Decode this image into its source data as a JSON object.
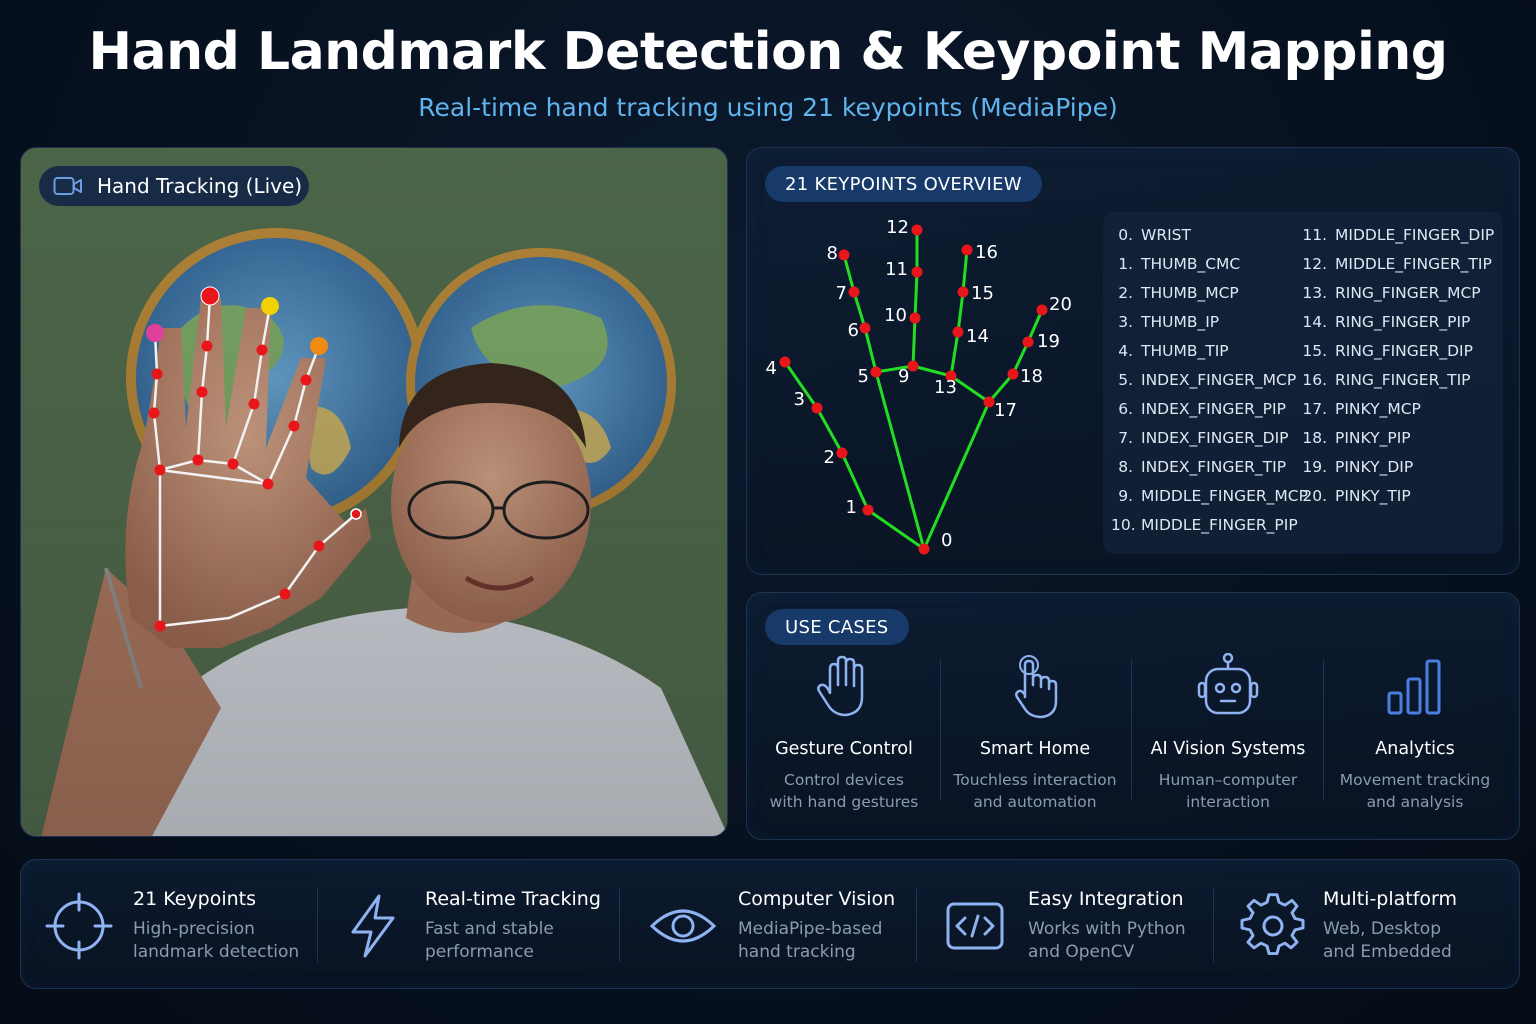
{
  "header": {
    "title": "Hand Landmark Detection & Keypoint Mapping",
    "subtitle": "Real-time hand tracking using 21 keypoints (MediaPipe)"
  },
  "camera": {
    "label": "Hand Tracking (Live)",
    "icon": "video-camera-icon"
  },
  "keypoints_panel": {
    "heading": "21 KEYPOINTS OVERVIEW",
    "diagram_labels": [
      "0",
      "1",
      "2",
      "3",
      "4",
      "5",
      "6",
      "7",
      "8",
      "9",
      "10",
      "11",
      "12",
      "13",
      "14",
      "15",
      "16",
      "17",
      "18",
      "19",
      "20"
    ],
    "list": [
      {
        "num": "0.",
        "name": "WRIST"
      },
      {
        "num": "1.",
        "name": "THUMB_CMC"
      },
      {
        "num": "2.",
        "name": "THUMB_MCP"
      },
      {
        "num": "3.",
        "name": "THUMB_IP"
      },
      {
        "num": "4.",
        "name": "THUMB_TIP"
      },
      {
        "num": "5.",
        "name": "INDEX_FINGER_MCP"
      },
      {
        "num": "6.",
        "name": "INDEX_FINGER_PIP"
      },
      {
        "num": "7.",
        "name": "INDEX_FINGER_DIP"
      },
      {
        "num": "8.",
        "name": "INDEX_FINGER_TIP"
      },
      {
        "num": "9.",
        "name": "MIDDLE_FINGER_MCP"
      },
      {
        "num": "10.",
        "name": "MIDDLE_FINGER_PIP"
      },
      {
        "num": "11.",
        "name": "MIDDLE_FINGER_DIP"
      },
      {
        "num": "12.",
        "name": "MIDDLE_FINGER_TIP"
      },
      {
        "num": "13.",
        "name": "RING_FINGER_MCP"
      },
      {
        "num": "14.",
        "name": "RING_FINGER_PIP"
      },
      {
        "num": "15.",
        "name": "RING_FINGER_DIP"
      },
      {
        "num": "16.",
        "name": "RING_FINGER_TIP"
      },
      {
        "num": "17.",
        "name": "PINKY_MCP"
      },
      {
        "num": "18.",
        "name": "PINKY_PIP"
      },
      {
        "num": "19.",
        "name": "PINKY_DIP"
      },
      {
        "num": "20.",
        "name": "PINKY_TIP"
      }
    ]
  },
  "use_cases": {
    "heading": "USE CASES",
    "items": [
      {
        "icon": "raised-hand-icon",
        "title": "Gesture Control",
        "desc1": "Control devices",
        "desc2": "with hand gestures"
      },
      {
        "icon": "pointing-hand-icon",
        "title": "Smart Home",
        "desc1": "Touchless interaction",
        "desc2": "and automation"
      },
      {
        "icon": "robot-icon",
        "title": "AI Vision Systems",
        "desc1": "Human–computer",
        "desc2": "interaction"
      },
      {
        "icon": "bar-chart-icon",
        "title": "Analytics",
        "desc1": "Movement tracking",
        "desc2": "and analysis"
      }
    ]
  },
  "features": [
    {
      "icon": "crosshair-icon",
      "title": "21 Keypoints",
      "desc1": "High-precision",
      "desc2": "landmark detection"
    },
    {
      "icon": "lightning-icon",
      "title": "Real-time Tracking",
      "desc1": "Fast and stable",
      "desc2": "performance"
    },
    {
      "icon": "eye-icon",
      "title": "Computer Vision",
      "desc1": "MediaPipe-based",
      "desc2": "hand tracking"
    },
    {
      "icon": "code-icon",
      "title": "Easy Integration",
      "desc1": "Works with Python",
      "desc2": "and OpenCV"
    },
    {
      "icon": "gear-icon",
      "title": "Multi-platform",
      "desc1": "Web, Desktop",
      "desc2": "and Embedded"
    }
  ],
  "colors": {
    "accent": "#5fb4ec",
    "skeleton": "#22dd22",
    "keypoint": "#e8151b",
    "pill": "#173a6b",
    "icon_blue": "#6d8fe0"
  }
}
